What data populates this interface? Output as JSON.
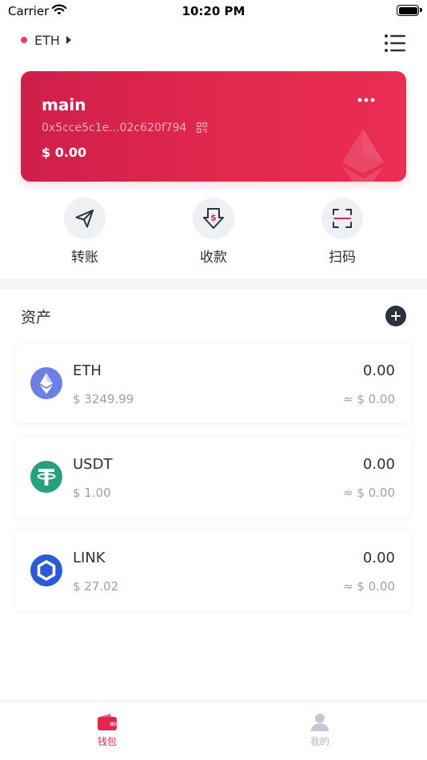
{
  "status_bar": {
    "carrier": "Carrier",
    "time": "10:20 PM"
  },
  "header": {
    "network": "ETH"
  },
  "wallet": {
    "name": "main",
    "address": "0x5cce5c1e...02c620f794",
    "balance": "$ 0.00"
  },
  "actions": [
    {
      "label": "转账",
      "icon": "send-icon"
    },
    {
      "label": "收款",
      "icon": "receive-icon"
    },
    {
      "label": "扫码",
      "icon": "scan-icon"
    }
  ],
  "assets": {
    "title": "资产",
    "items": [
      {
        "symbol": "ETH",
        "price": "$ 3249.99",
        "amount": "0.00",
        "value": "≈ $ 0.00"
      },
      {
        "symbol": "USDT",
        "price": "$ 1.00",
        "amount": "0.00",
        "value": "≈ $ 0.00"
      },
      {
        "symbol": "LINK",
        "price": "$ 27.02",
        "amount": "0.00",
        "value": "≈ $ 0.00"
      }
    ]
  },
  "tab_bar": {
    "tabs": [
      {
        "label": "钱包",
        "active": true
      },
      {
        "label": "我的",
        "active": false
      }
    ]
  },
  "colors": {
    "accent": "#e2284f",
    "eth_logo": "#6b7fe6",
    "usdt_logo": "#26a17b",
    "link_logo": "#2a5ada",
    "tab_inactive": "#b3b8c2"
  }
}
